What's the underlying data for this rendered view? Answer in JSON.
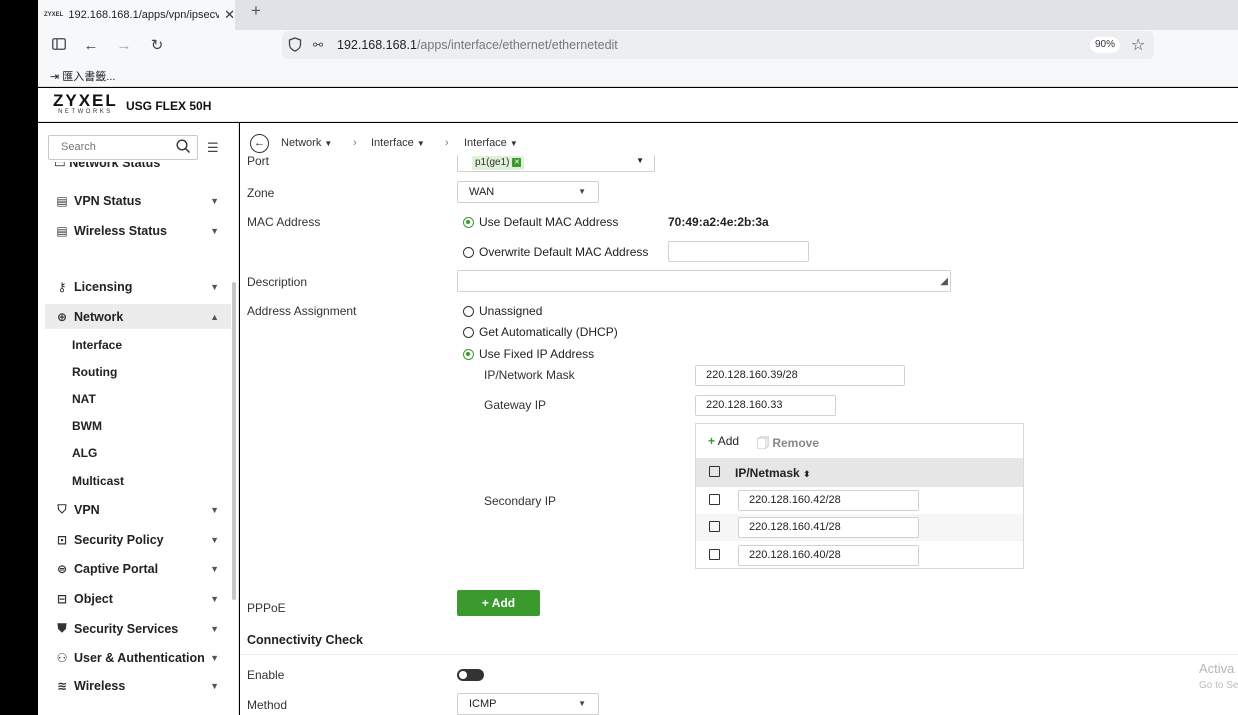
{
  "browser": {
    "tab_favicon": "ZYXEL",
    "tab_title": "192.168.168.1/apps/vpn/ipsecvp",
    "url_host": "192.168.168.1",
    "url_path": "/apps/interface/ethernet/ethernetedit",
    "zoom": "90%",
    "bookmark": "匯入書籤..."
  },
  "app": {
    "logo": "ZYXEL",
    "logo_sub": "NETWORKS",
    "model": "USG FLEX 50H"
  },
  "sidebar": {
    "search_placeholder": "Search",
    "items": [
      {
        "label": "VPN Status",
        "icon": "vpn-status-icon"
      },
      {
        "label": "Wireless Status",
        "icon": "wireless-status-icon"
      },
      {
        "label": "Licensing",
        "icon": "key-icon"
      },
      {
        "label": "Network",
        "icon": "globe-icon"
      },
      {
        "label": "VPN",
        "icon": "shield-icon"
      },
      {
        "label": "Security Policy",
        "icon": "security-policy-icon"
      },
      {
        "label": "Captive Portal",
        "icon": "captive-portal-icon"
      },
      {
        "label": "Object",
        "icon": "object-icon"
      },
      {
        "label": "Security Services",
        "icon": "shield-check-icon"
      },
      {
        "label": "User & Authentication",
        "icon": "users-icon"
      },
      {
        "label": "Wireless",
        "icon": "wifi-icon"
      }
    ],
    "network_sub": [
      "Interface",
      "Routing",
      "NAT",
      "BWM",
      "ALG",
      "Multicast"
    ]
  },
  "breadcrumb": [
    "Network",
    "Interface",
    "Interface"
  ],
  "form": {
    "port_label": "Port",
    "port_value": "p1(ge1)",
    "zone_label": "Zone",
    "zone_value": "WAN",
    "mac_label": "MAC Address",
    "mac_default_option": "Use Default MAC Address",
    "mac_default_value": "70:49:a2:4e:2b:3a",
    "mac_overwrite_option": "Overwrite Default MAC Address",
    "description_label": "Description",
    "address_label": "Address Assignment",
    "addr_unassigned": "Unassigned",
    "addr_dhcp": "Get Automatically (DHCP)",
    "addr_fixed": "Use Fixed IP Address",
    "ip_mask_label": "IP/Network Mask",
    "ip_mask_value": "220.128.160.39/28",
    "gateway_label": "Gateway IP",
    "gateway_value": "220.128.160.33",
    "secondary_label": "Secondary IP",
    "sec_add": "Add",
    "sec_remove": "Remove",
    "sec_col": "IP/Netmask",
    "sec_rows": [
      "220.128.160.42/28",
      "220.128.160.41/28",
      "220.128.160.40/28"
    ],
    "pppoe_label": "PPPoE",
    "pppoe_add": "Add",
    "conn_check_heading": "Connectivity Check",
    "enable_label": "Enable",
    "method_label": "Method",
    "method_value": "ICMP"
  },
  "watermark": {
    "line1": "Activa",
    "line2": "Go to Se"
  },
  "colors": {
    "accent_green": "#3a9a2e"
  }
}
